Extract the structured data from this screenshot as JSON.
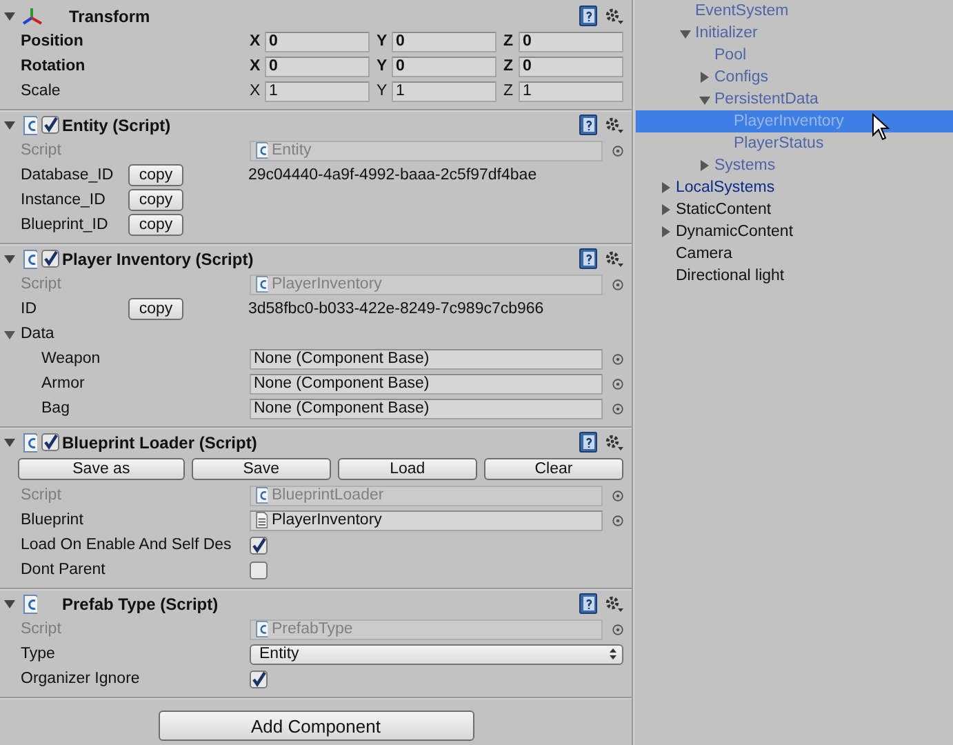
{
  "inspector": {
    "components": [
      {
        "kind": "transform",
        "title": "Transform",
        "expanded": true,
        "rows": [
          {
            "kind": "vector3",
            "label": "Position",
            "bold": true,
            "fields": [
              {
                "axis": "X",
                "value": "0"
              },
              {
                "axis": "Y",
                "value": "0"
              },
              {
                "axis": "Z",
                "value": "0"
              }
            ]
          },
          {
            "kind": "vector3",
            "label": "Rotation",
            "bold": true,
            "fields": [
              {
                "axis": "X",
                "value": "0"
              },
              {
                "axis": "Y",
                "value": "0"
              },
              {
                "axis": "Z",
                "value": "0"
              }
            ]
          },
          {
            "kind": "vector3",
            "label": "Scale",
            "bold": false,
            "fields": [
              {
                "axis": "X",
                "value": "1"
              },
              {
                "axis": "Y",
                "value": "1"
              },
              {
                "axis": "Z",
                "value": "1"
              }
            ]
          }
        ]
      },
      {
        "kind": "script",
        "title": "Entity (Script)",
        "expanded": true,
        "enabled": true,
        "rows": [
          {
            "kind": "script_ref",
            "label": "Script",
            "value": "Entity",
            "disabled": true
          },
          {
            "kind": "id",
            "label": "Database_ID",
            "button": "copy",
            "value": "29c04440-4a9f-4992-baaa-2c5f97df4bae"
          },
          {
            "kind": "id",
            "label": "Instance_ID",
            "button": "copy"
          },
          {
            "kind": "id",
            "label": "Blueprint_ID",
            "button": "copy"
          }
        ]
      },
      {
        "kind": "script",
        "title": "Player Inventory (Script)",
        "expanded": true,
        "enabled": true,
        "rows": [
          {
            "kind": "script_ref",
            "label": "Script",
            "value": "PlayerInventory",
            "disabled": true
          },
          {
            "kind": "id",
            "label": "ID",
            "button": "copy",
            "value": "3d58fbc0-b033-422e-8249-7c989c7cb966"
          },
          {
            "kind": "foldout",
            "label": "Data",
            "expanded": true,
            "children": [
              {
                "kind": "object",
                "label": "Weapon",
                "value": "None (Component Base)",
                "disabled": false
              },
              {
                "kind": "object",
                "label": "Armor",
                "value": "None (Component Base)",
                "disabled": false
              },
              {
                "kind": "object",
                "label": "Bag",
                "value": "None (Component Base)",
                "disabled": false
              }
            ]
          }
        ]
      },
      {
        "kind": "script",
        "title": "Blueprint Loader (Script)",
        "expanded": true,
        "enabled": true,
        "rows": [
          {
            "kind": "buttons",
            "buttons": [
              "Save as",
              "Save",
              "Load",
              "Clear"
            ]
          },
          {
            "kind": "script_ref",
            "label": "Script",
            "value": "BlueprintLoader",
            "disabled": true
          },
          {
            "kind": "asset_ref",
            "label": "Blueprint",
            "value": "PlayerInventory",
            "disabled": false
          },
          {
            "kind": "toggle",
            "label": "Load On Enable And Self Des",
            "checked": true
          },
          {
            "kind": "toggle",
            "label": "Dont Parent",
            "checked": false
          }
        ]
      },
      {
        "kind": "script",
        "title": "Prefab Type (Script)",
        "expanded": true,
        "rows": [
          {
            "kind": "script_ref",
            "label": "Script",
            "value": "PrefabType",
            "disabled": true
          },
          {
            "kind": "enum",
            "label": "Type",
            "value": "Entity"
          },
          {
            "kind": "toggle",
            "label": "Organizer Ignore",
            "checked": true
          }
        ]
      }
    ],
    "add_button": "Add Component"
  },
  "hierarchy": {
    "partial_items": [
      {
        "label": "EventSystem",
        "kind": "prefab-inactive",
        "selected": false
      },
      {
        "label": "Initializer",
        "kind": "prefab-inactive",
        "selected": false,
        "expanded": true,
        "children": [
          {
            "label": "Pool",
            "kind": "prefab-inactive",
            "selected": false
          },
          {
            "label": "Configs",
            "kind": "prefab-inactive",
            "selected": false,
            "expanded": false
          },
          {
            "label": "PersistentData",
            "kind": "prefab-inactive",
            "selected": false,
            "expanded": true,
            "children": [
              {
                "label": "PlayerInventory",
                "kind": "prefab-inactive",
                "selected": true
              },
              {
                "label": "PlayerStatus",
                "kind": "prefab-inactive",
                "selected": false
              }
            ]
          },
          {
            "label": "Systems",
            "kind": "prefab-inactive",
            "selected": false,
            "expanded": false
          }
        ]
      }
    ],
    "items": [
      {
        "label": "LocalSystems",
        "kind": "prefab",
        "selected": false,
        "expanded": false
      },
      {
        "label": "StaticContent",
        "kind": "object",
        "selected": false,
        "expanded": false
      },
      {
        "label": "DynamicContent",
        "kind": "object",
        "selected": false,
        "expanded": false
      },
      {
        "label": "Camera",
        "kind": "object",
        "selected": false
      },
      {
        "label": "Directional light",
        "kind": "object",
        "selected": false
      }
    ]
  }
}
